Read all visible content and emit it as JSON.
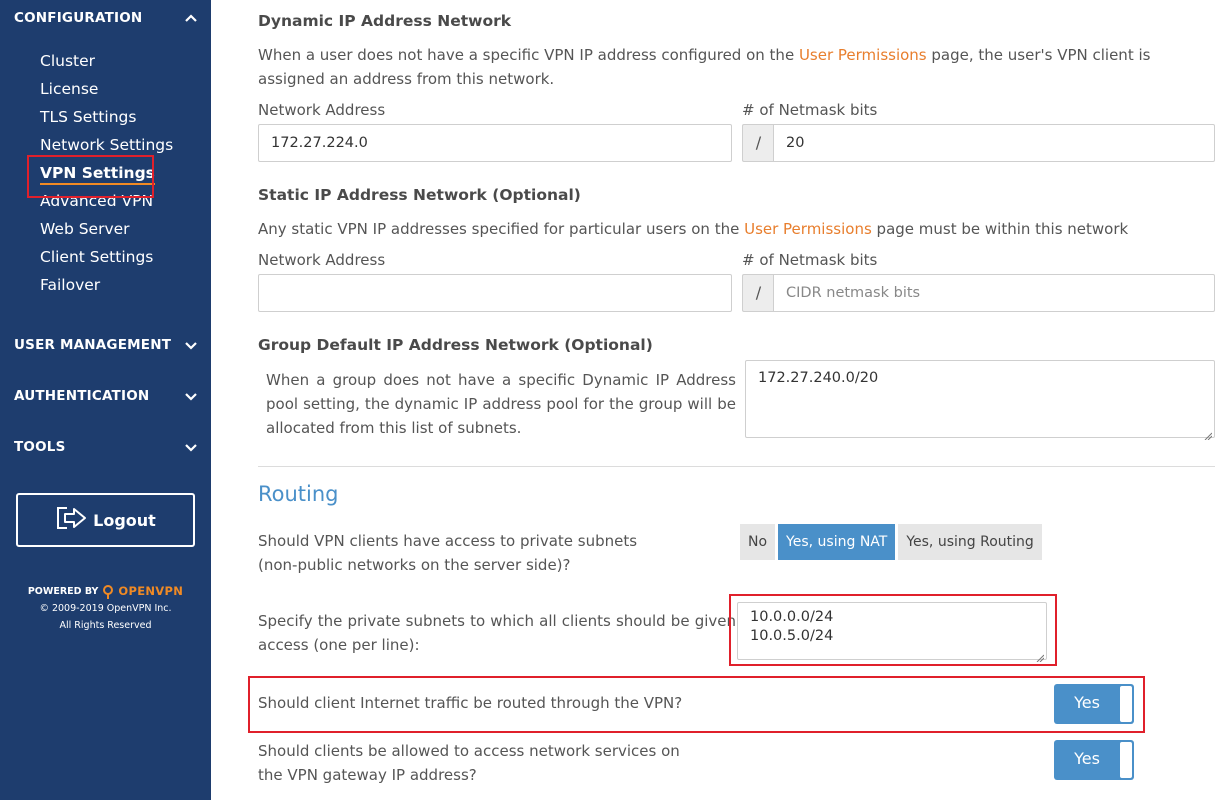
{
  "sidebar": {
    "configuration_label": "CONFIGURATION",
    "items": [
      {
        "label": "Cluster"
      },
      {
        "label": "License"
      },
      {
        "label": "TLS Settings"
      },
      {
        "label": "Network Settings"
      },
      {
        "label": "VPN Settings"
      },
      {
        "label": "Advanced VPN"
      },
      {
        "label": "Web Server"
      },
      {
        "label": "Client Settings"
      },
      {
        "label": "Failover"
      }
    ],
    "sections": [
      {
        "label": "USER MANAGEMENT"
      },
      {
        "label": "AUTHENTICATION"
      },
      {
        "label": "TOOLS"
      }
    ],
    "logout_label": "Logout",
    "powered_by": "POWERED BY",
    "brand": "OPENVPN",
    "copyright": "© 2009-2019 OpenVPN Inc.",
    "rights": "All Rights Reserved"
  },
  "dynamic": {
    "title": "Dynamic IP Address Network",
    "desc_pre": "When a user does not have a specific VPN IP address configured on the ",
    "desc_link": "User Permissions",
    "desc_post": " page, the user's VPN client is assigned an address from this network.",
    "network_label": "Network Address",
    "network_value": "172.27.224.0",
    "netmask_label": "# of Netmask bits",
    "netmask_value": "20",
    "slash": "/"
  },
  "static": {
    "title": "Static IP Address Network (Optional)",
    "desc_pre": "Any static VPN IP addresses specified for particular users on the ",
    "desc_link": "User Permissions",
    "desc_post": " page must be within this network",
    "network_label": "Network Address",
    "network_value": "",
    "netmask_label": "# of Netmask bits",
    "netmask_placeholder": "CIDR netmask bits",
    "slash": "/"
  },
  "group": {
    "title": "Group Default IP Address Network (Optional)",
    "desc": "When a group does not have a specific Dynamic IP Address pool setting, the dynamic IP address pool for the group will be allocated from this list of subnets.",
    "value": "172.27.240.0/20"
  },
  "routing": {
    "title": "Routing",
    "private_q_line1": "Should VPN clients have access to private subnets",
    "private_q_line2": "(non-public networks on the server side)?",
    "options": [
      "No",
      "Yes, using NAT",
      "Yes, using Routing"
    ],
    "selected_option": "Yes, using NAT",
    "subnets_q": "Specify the private subnets to which all clients should be given access (one per line):",
    "subnets": [
      "10.0.0.0/24",
      "10.0.5.0/24"
    ],
    "internet_q": "Should client Internet traffic be routed through the VPN?",
    "internet_value": "Yes",
    "gateway_q_line1": "Should clients be allowed to access network services on",
    "gateway_q_line2": "the VPN gateway IP address?",
    "gateway_value": "Yes"
  },
  "colors": {
    "sidebar_bg": "#1e3d6e",
    "accent": "#4a90c9",
    "link": "#e87e2d",
    "highlight": "#e0202b"
  }
}
